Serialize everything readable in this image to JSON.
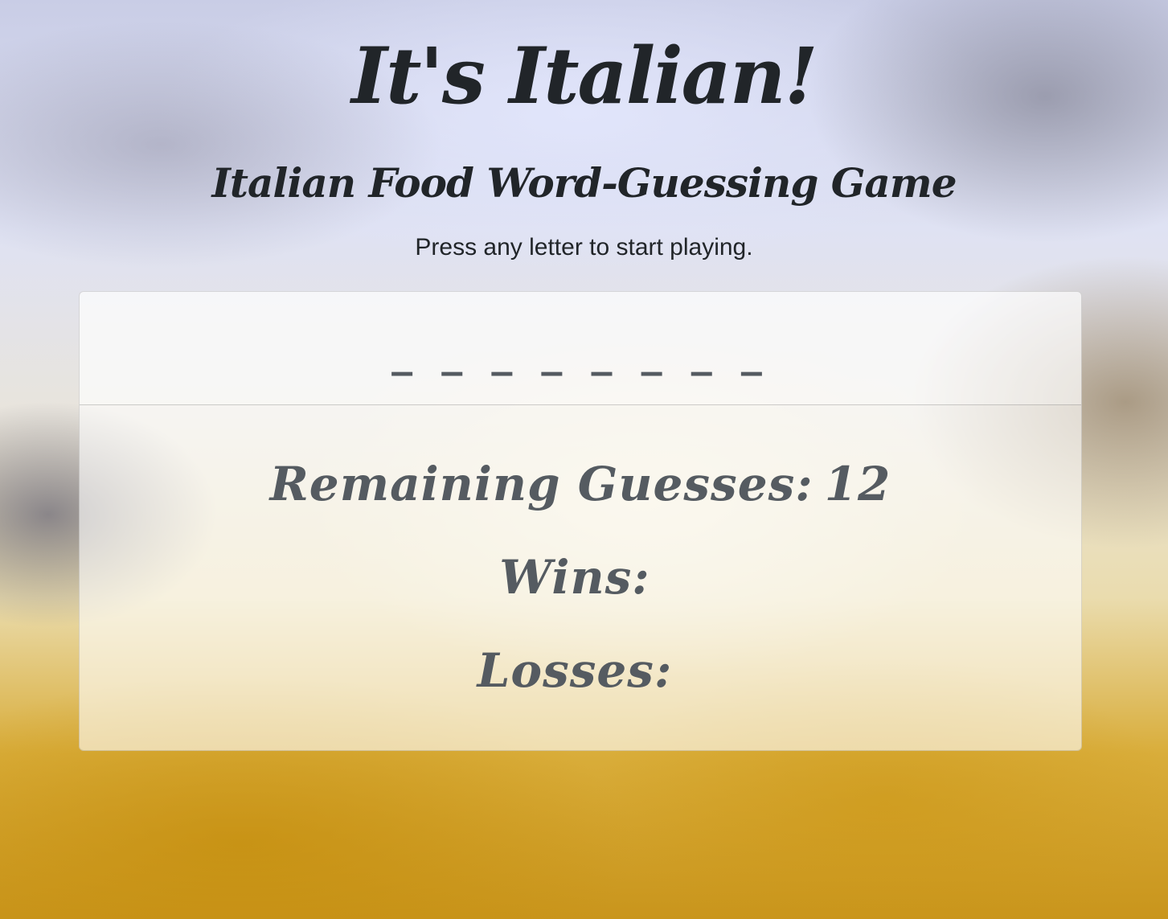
{
  "header": {
    "title": "It's Italian!",
    "subtitle": "Italian Food Word-Guessing Game",
    "instruction": "Press any letter to start playing."
  },
  "game": {
    "word_blanks": "_ _ _ _ _ _ _ _",
    "remaining_label": "Remaining Guesses:",
    "remaining_value": "12",
    "wins_label": "Wins:",
    "wins_value": "",
    "losses_label": "Losses:",
    "losses_value": ""
  }
}
